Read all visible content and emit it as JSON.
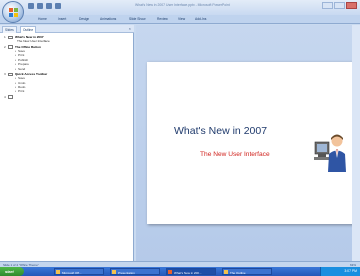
{
  "window": {
    "title": "What's New in 2007 User Interface.pptx - Microsoft PowerPoint",
    "ribbon_tabs": [
      "Home",
      "Insert",
      "Design",
      "Animations",
      "Slide Show",
      "Review",
      "View",
      "Add-Ins"
    ]
  },
  "quick_access": {
    "icons": [
      "save-icon",
      "undo-icon",
      "redo-icon",
      "customize-icon"
    ]
  },
  "outline_pane": {
    "tabs": [
      "Slides",
      "Outline"
    ],
    "active_tab": "Outline",
    "close_glyph": "×",
    "rows": [
      {
        "num": "1",
        "text": "What's New in 2007",
        "kind": "head"
      },
      {
        "num": "",
        "text": "The New User Interface",
        "kind": "sub"
      },
      {
        "num": "2",
        "text": "The Office Button",
        "kind": "head"
      },
      {
        "num": "",
        "text": "Save",
        "kind": "bul"
      },
      {
        "num": "",
        "text": "Print",
        "kind": "bul"
      },
      {
        "num": "",
        "text": "Publish",
        "kind": "bul"
      },
      {
        "num": "",
        "text": "Prepare",
        "kind": "bul"
      },
      {
        "num": "",
        "text": "Send",
        "kind": "bul"
      },
      {
        "num": "3",
        "text": "Quick Access Toolbar",
        "kind": "head"
      },
      {
        "num": "",
        "text": "Save",
        "kind": "bul"
      },
      {
        "num": "",
        "text": "Undo",
        "kind": "bul"
      },
      {
        "num": "",
        "text": "Redo",
        "kind": "bul"
      },
      {
        "num": "",
        "text": "Print",
        "kind": "bul"
      },
      {
        "num": "4",
        "text": "",
        "kind": "head"
      }
    ]
  },
  "slide": {
    "title": "What's New in 2007",
    "subtitle": "The New User Interface",
    "title_color": "#1f3a6c",
    "subtitle_color": "#d0231e"
  },
  "status_bar": {
    "left": "Slide 1 of 4    \"Office Theme\"",
    "right": "63%"
  },
  "taskbar": {
    "start_label": "start",
    "tasks": [
      "Microsoft Off...",
      "Presentation",
      "What's New in 200...",
      "The Outline"
    ],
    "clock": "3:07 PM"
  }
}
